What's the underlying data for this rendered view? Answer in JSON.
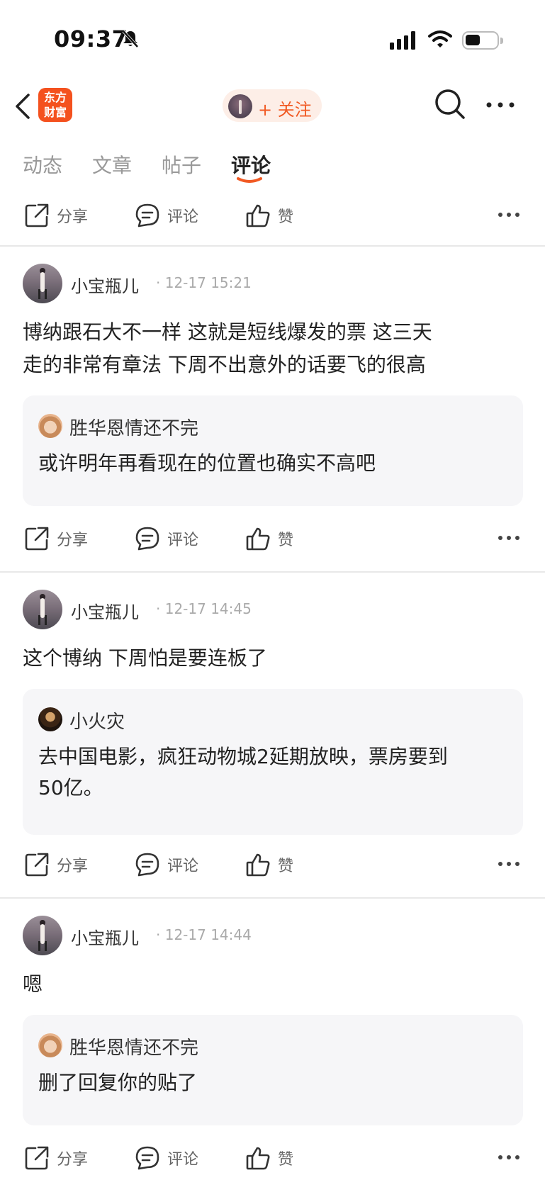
{
  "status_bar": {
    "time": "09:37"
  },
  "nav": {
    "logo_line1": "东方",
    "logo_line2": "财富",
    "follow_label": "+ 关注"
  },
  "tabs": [
    {
      "label": "动态",
      "active": false
    },
    {
      "label": "文章",
      "active": false
    },
    {
      "label": "帖子",
      "active": false
    },
    {
      "label": "评论",
      "active": true
    }
  ],
  "actions": {
    "share": "分享",
    "comment": "评论",
    "like": "赞"
  },
  "comments": [
    {
      "author": "小宝瓶儿",
      "time": "· 12-17 15:21",
      "text_line1": "博纳跟石大不一样 这就是短线爆发的票 这三天",
      "text_line2": "走的非常有章法 下周不出意外的话要飞的很高",
      "reply": {
        "author": "胜华恩情还不完",
        "avatar": "monkey-avatar",
        "text_line1": "或许明年再看现在的位置也确实不高吧",
        "text_line2": ""
      }
    },
    {
      "author": "小宝瓶儿",
      "time": "· 12-17 14:45",
      "text_line1": "这个博纳 下周怕是要连板了",
      "text_line2": "",
      "reply": {
        "author": "小火灾",
        "avatar": "person-avatar",
        "text_line1": "去中国电影，疯狂动物城2延期放映，票房要到",
        "text_line2": "50亿。"
      }
    },
    {
      "author": "小宝瓶儿",
      "time": "· 12-17 14:44",
      "text_line1": "嗯",
      "text_line2": "",
      "reply": {
        "author": "胜华恩情还不完",
        "avatar": "monkey-avatar",
        "text_line1": "删了回复你的贴了",
        "text_line2": ""
      }
    }
  ],
  "colors": {
    "brand_orange": "#f15a24",
    "logo_bg": "#f4511e",
    "reply_bg": "#f6f6f8",
    "muted_text": "#999999"
  }
}
